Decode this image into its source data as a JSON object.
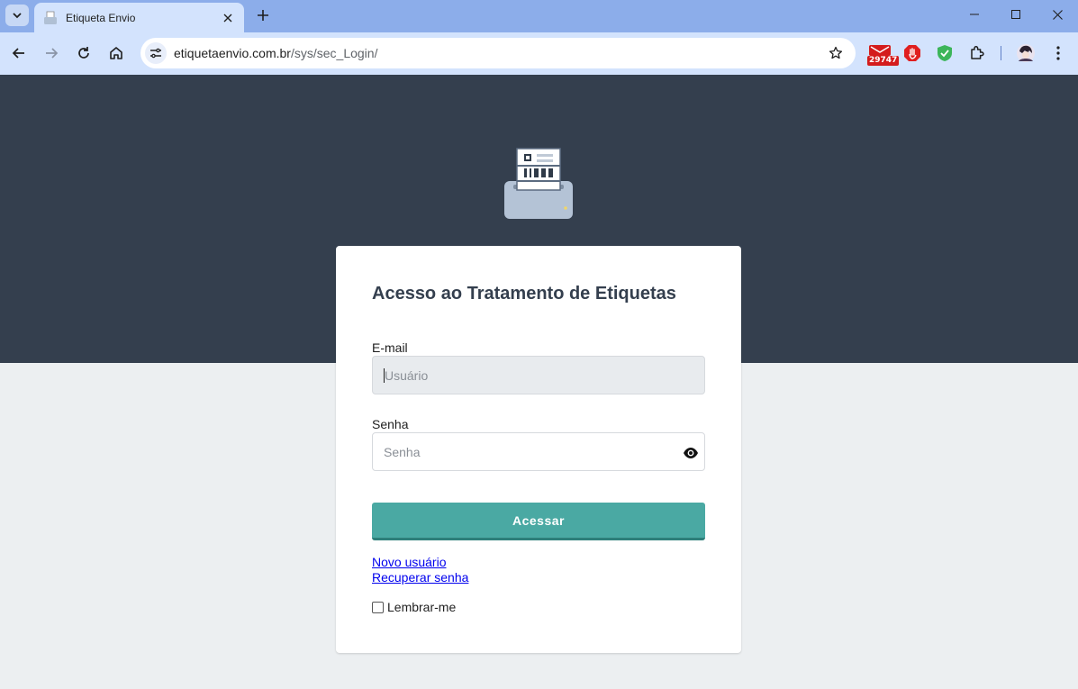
{
  "browser": {
    "tab_title": "Etiqueta Envio",
    "url_host": "etiquetaenvio.com.br",
    "url_path": "/sys/sec_Login/",
    "extension_badge": "29747"
  },
  "login": {
    "title": "Acesso ao Tratamento de Etiquetas",
    "email_label": "E-mail",
    "email_placeholder": "Usuário",
    "password_label": "Senha",
    "password_placeholder": "Senha",
    "submit_label": "Acessar",
    "new_user_link": "Novo usuário",
    "recover_link": "Recuperar senha",
    "remember_label": "Lembrar-me"
  },
  "colors": {
    "hero": "#343f4e",
    "accent": "#4aa9a3",
    "background": "#eceff1"
  }
}
